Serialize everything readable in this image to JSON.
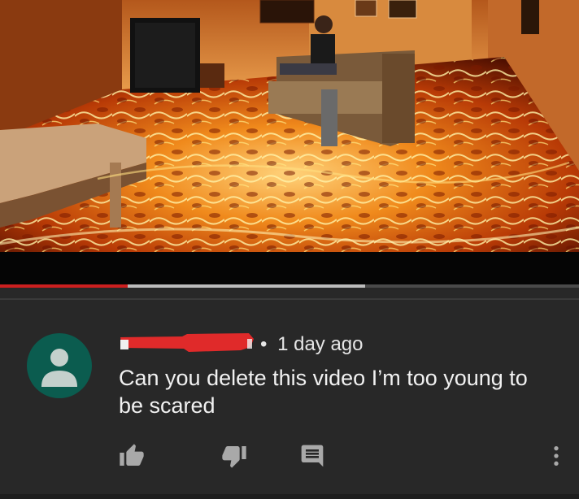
{
  "video": {
    "progress_played": 0.22,
    "progress_buffered": 0.63
  },
  "comment": {
    "author": "",
    "time_ago": "1 day ago",
    "separator": "•",
    "text": "Can you delete this video I’m too young to be scared",
    "avatar_icon": "default-user-icon"
  },
  "actions": {
    "like_icon": "thumbs-up-icon",
    "dislike_icon": "thumbs-down-icon",
    "reply_icon": "reply-comment-icon",
    "more_icon": "more-vertical-icon"
  },
  "colors": {
    "background": "#282828",
    "progress_played": "#cc1f1f",
    "progress_buffered": "#bcbcbc",
    "avatar": "#0b5c4f",
    "redaction": "#e02a2a"
  }
}
